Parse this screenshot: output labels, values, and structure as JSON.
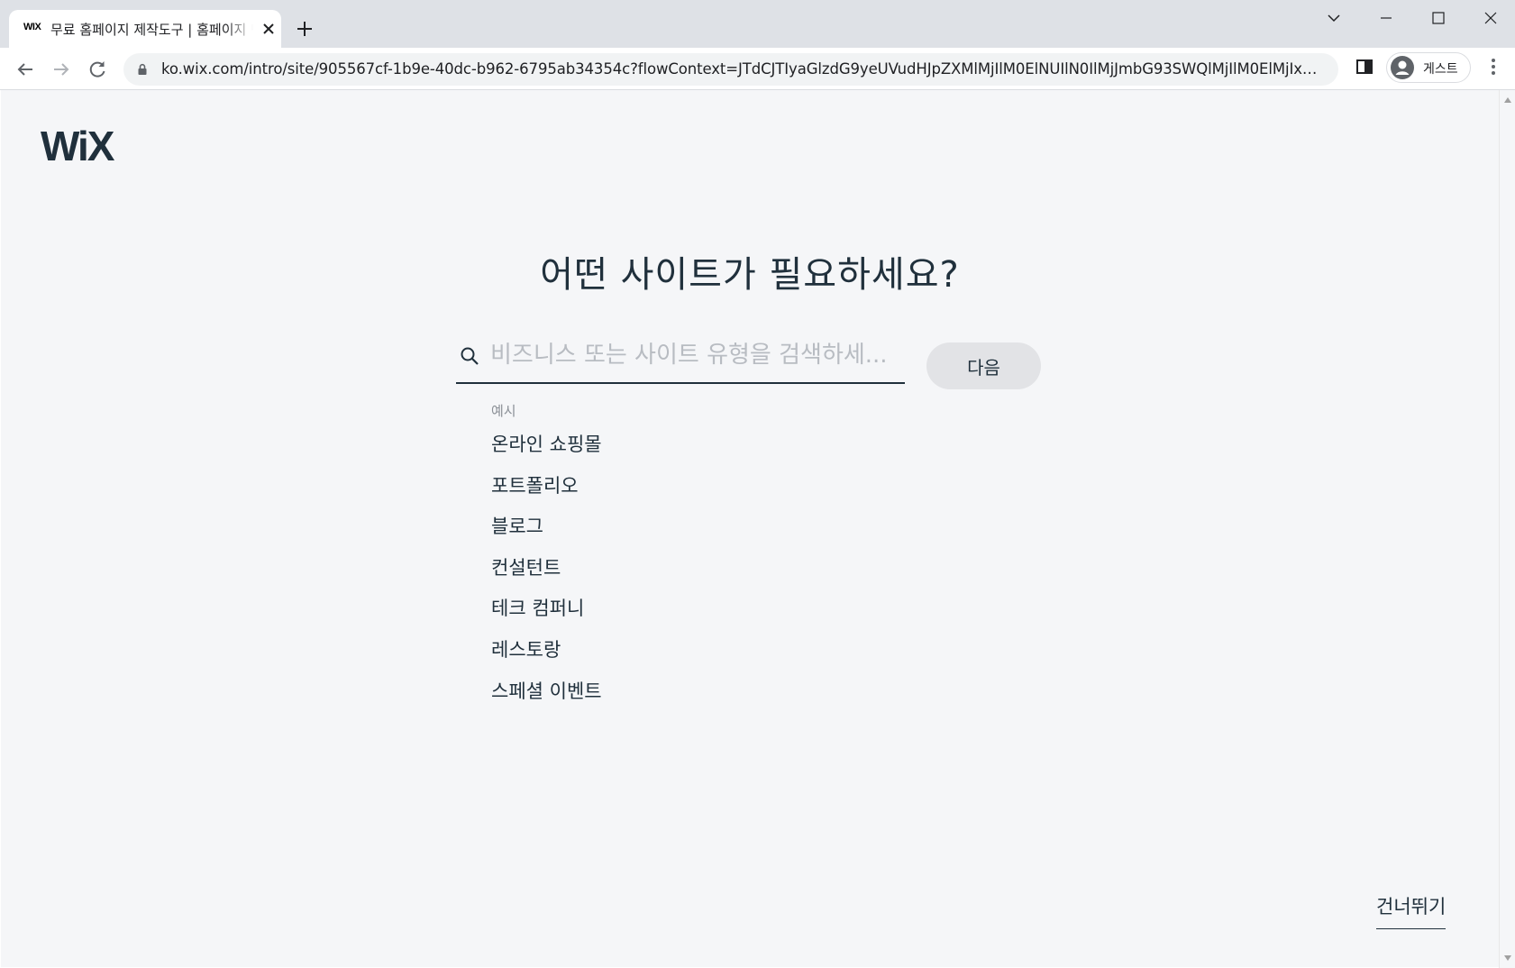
{
  "browser": {
    "tab": {
      "favicon_text": "WIX",
      "title": "무료 홈페이지 제작도구 | 홈페이지 만들기 | Wix.com"
    },
    "address_bar": {
      "url": "ko.wix.com/intro/site/905567cf-1b9e-40dc-b962-6795ab34354c?flowContext=JTdCJTIyaGlzdG9yeUVudHJpZXMlMjIlM0ElNUIlN0IlMjJmbG93SWQlMjIlM0ElMjIxOW..."
    },
    "profile": {
      "label": "게스트"
    }
  },
  "page": {
    "logo_text": "WiX",
    "heading": "어떤 사이트가 필요하세요?",
    "search": {
      "placeholder": "비즈니스 또는 사이트 유형을 검색하세...",
      "value": ""
    },
    "next_button_label": "다음",
    "examples_label": "예시",
    "examples": [
      "온라인 쇼핑몰",
      "포트폴리오",
      "블로그",
      "컨설턴트",
      "테크 컴퍼니",
      "레스토랑",
      "스페셜 이벤트"
    ],
    "skip_label": "건너뛰기"
  },
  "colors": {
    "page_background": "#f5f6f8",
    "text_primary": "#20303c",
    "placeholder": "#b8bcc2",
    "button_background": "#e2e3e6",
    "tabstrip": "#dee1e6"
  }
}
